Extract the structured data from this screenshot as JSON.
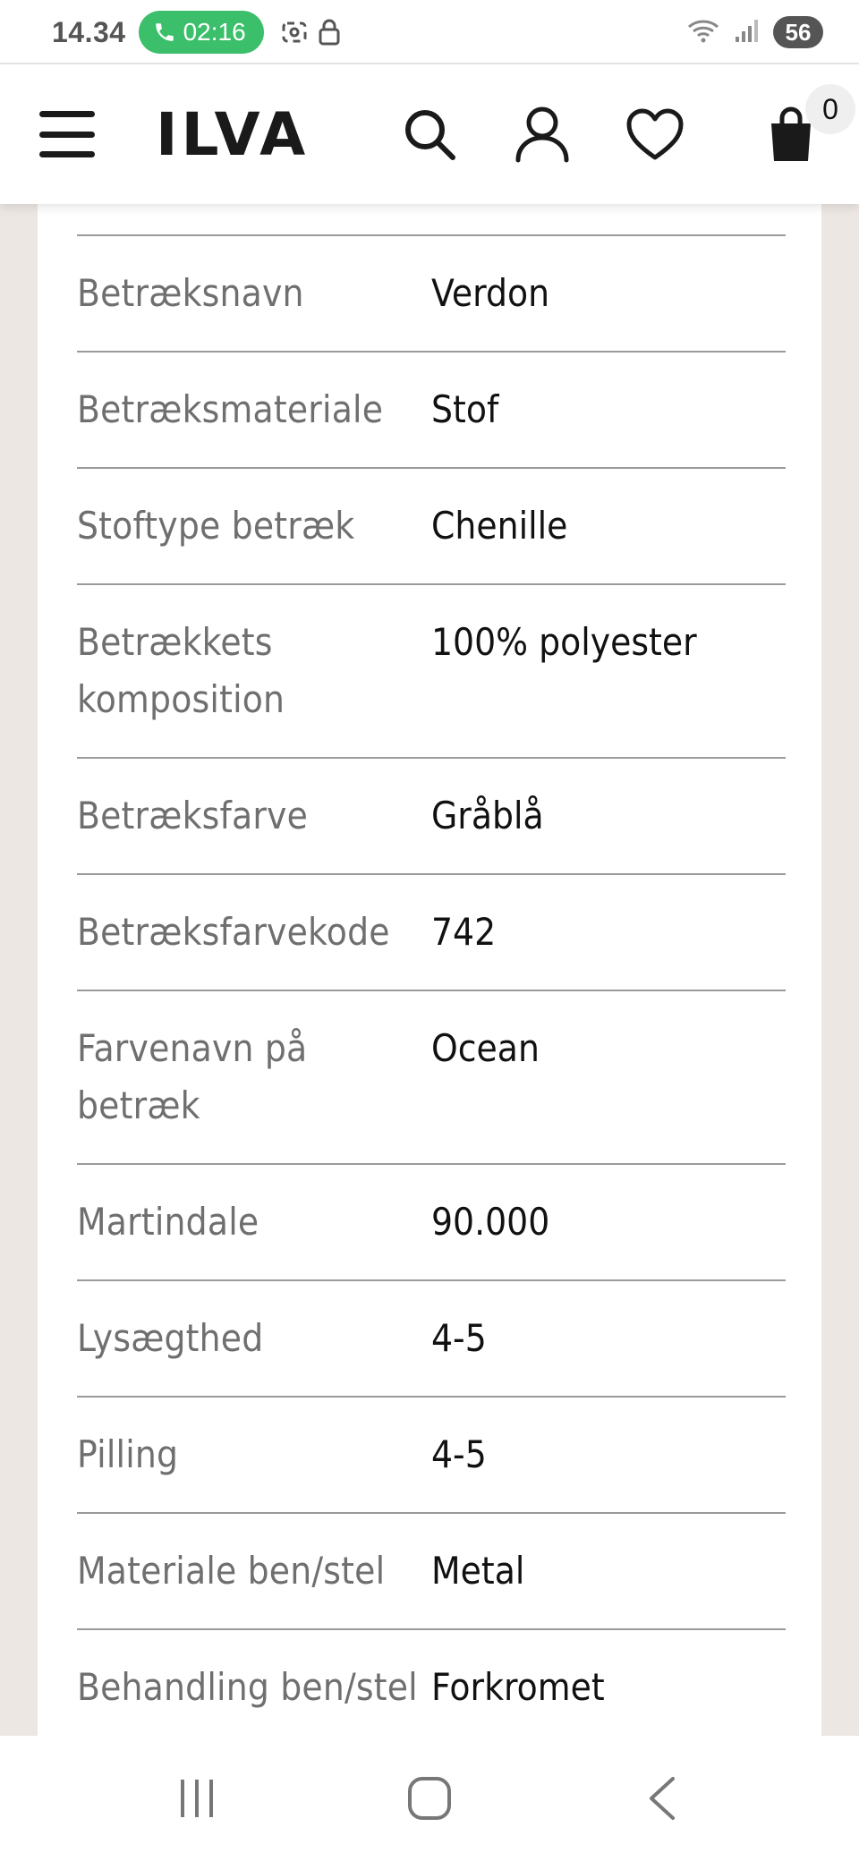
{
  "status_bar": {
    "time": "14.34",
    "call_timer": "02:16",
    "battery": "56"
  },
  "header": {
    "logo": "ILVA",
    "cart_count": "0"
  },
  "specs": [
    {
      "label": "Betræksnavn",
      "value": "Verdon"
    },
    {
      "label": "Betræksmateriale",
      "value": "Stof"
    },
    {
      "label": "Stoftype betræk",
      "value": "Chenille"
    },
    {
      "label": "Betrækkets komposition",
      "value": "100% polyester"
    },
    {
      "label": "Betræksfarve",
      "value": "Gråblå"
    },
    {
      "label": "Betræksfarvekode",
      "value": "742"
    },
    {
      "label": "Farvenavn på betræk",
      "value": "Ocean"
    },
    {
      "label": "Martindale",
      "value": "90.000"
    },
    {
      "label": "Lysægthed",
      "value": "4-5"
    },
    {
      "label": "Pilling",
      "value": "4-5"
    },
    {
      "label": "Materiale ben/stel",
      "value": "Metal"
    },
    {
      "label": "Behandling ben/stel",
      "value": "Forkromet"
    }
  ],
  "icons": {
    "menu": "hamburger-menu-icon",
    "search": "search-icon",
    "account": "user-icon",
    "wishlist": "heart-icon",
    "cart": "shopping-bag-icon",
    "nav_recent": "recent-apps-icon",
    "nav_home": "home-icon",
    "nav_back": "back-icon"
  },
  "colors": {
    "call_pill": "#3bbf6a",
    "background": "#ece7e3",
    "label_text": "#6f6f6f",
    "value_text": "#111111"
  }
}
